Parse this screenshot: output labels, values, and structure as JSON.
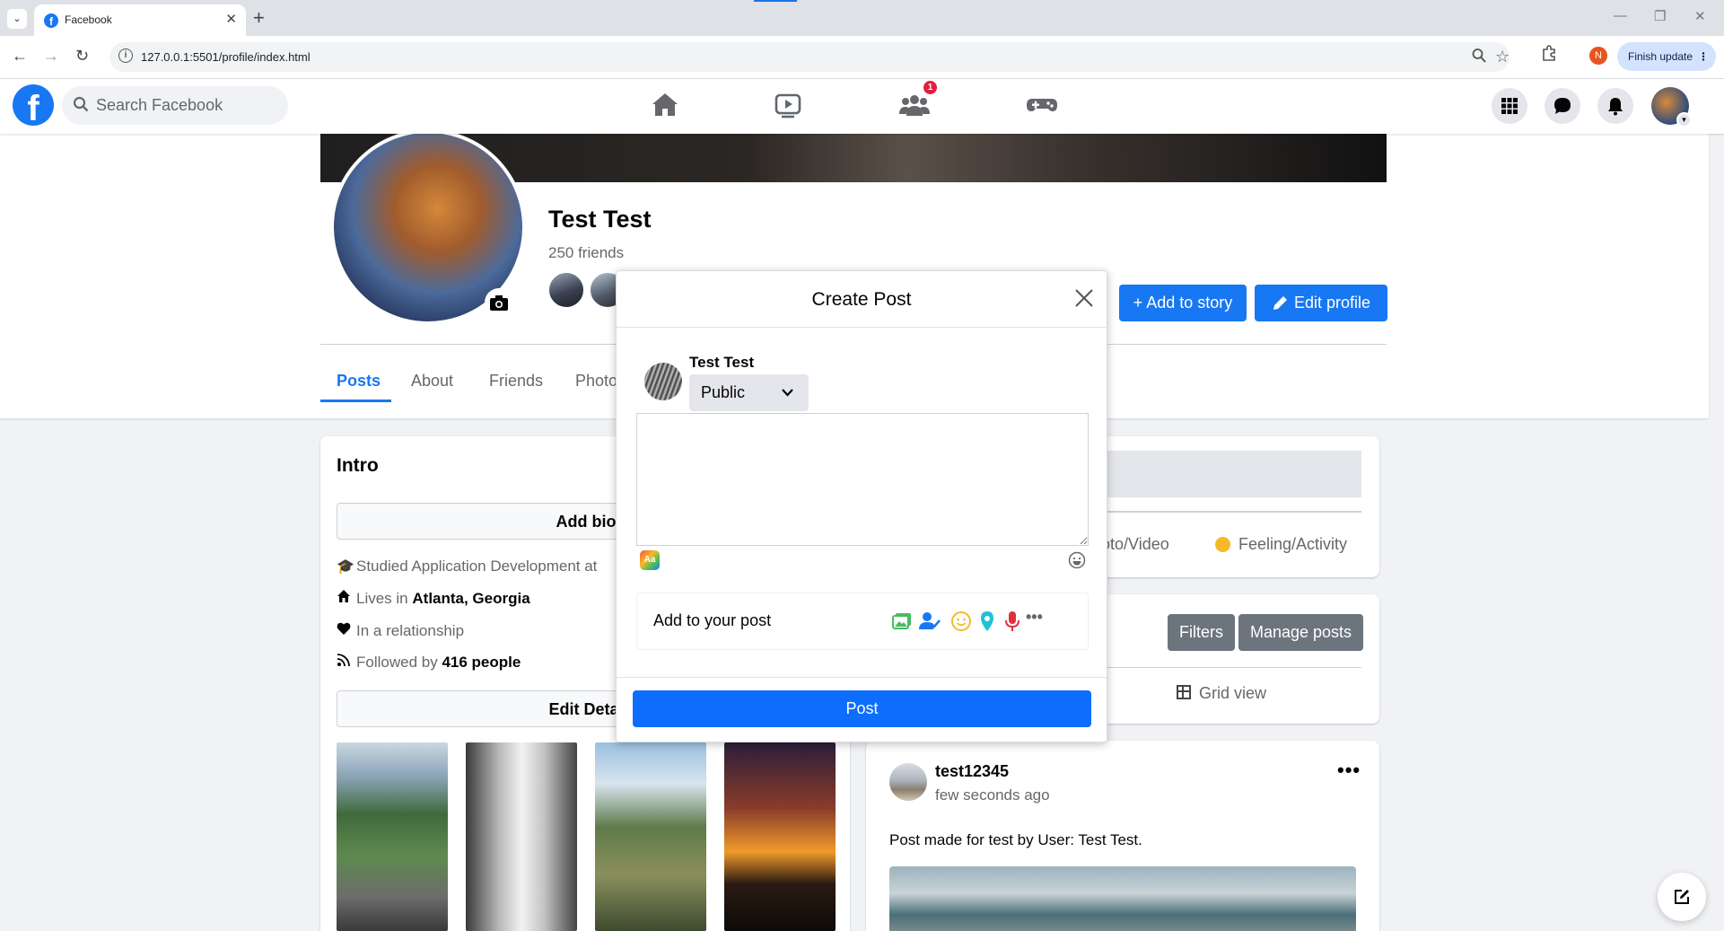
{
  "browser": {
    "tab_title": "Facebook",
    "tab_close": "✕",
    "new_tab": "+",
    "url": "127.0.0.1:5501/profile/index.html",
    "profile_initial": "N",
    "finish_update": "Finish update",
    "menu_glyph": "⋮"
  },
  "header": {
    "logo_letter": "f",
    "search_placeholder": "Search Facebook",
    "friends_badge": "1"
  },
  "profile": {
    "name": "Test Test",
    "friends": "250 friends",
    "add_to_story": "+ Add to story",
    "edit_profile": "Edit profile",
    "tabs": [
      "Posts",
      "About",
      "Friends",
      "Photo"
    ]
  },
  "intro": {
    "title": "Intro",
    "add_bio": "Add bio",
    "studied_prefix": "Studied Application Development at",
    "lives_prefix": "Lives in ",
    "lives_place": "Atlanta, Georgia",
    "relationship": "In a relationship",
    "followed_prefix": "Followed by ",
    "followed_count": "416 people",
    "edit_details": "Edit Detai"
  },
  "composer": {
    "photo_video": "oto/Video",
    "feeling": "Feeling/Activity"
  },
  "posts_bar": {
    "filters": "Filters",
    "manage": "Manage posts",
    "grid_view": "Grid view"
  },
  "post": {
    "user": "test12345",
    "time": "few seconds ago",
    "text": "Post made for test by User: Test Test.",
    "more": "•••"
  },
  "modal": {
    "title": "Create Post",
    "user": "Test Test",
    "privacy": "Public",
    "aa": "Aa",
    "add_to_post": "Add to your post",
    "more": "•••",
    "post_button": "Post"
  },
  "colors": {
    "facebook_blue": "#1877f2",
    "post_button": "#0d6efd",
    "secondary_button": "#6c757d",
    "badge_red": "#e41e3f"
  }
}
